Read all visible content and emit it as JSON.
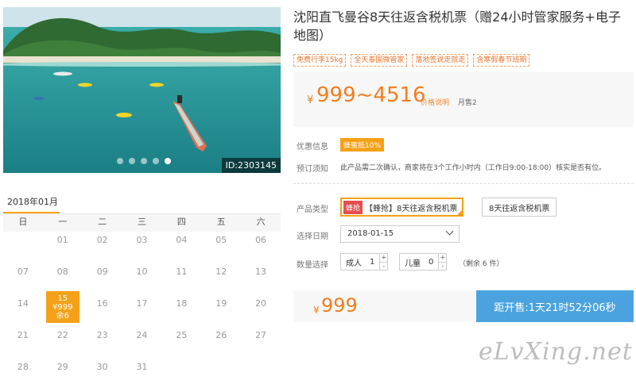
{
  "product": {
    "title": "沈阳直飞曼谷8天往返含税机票（赠24小时管家服务+电子地图）",
    "tags": [
      "免费行李15kg",
      "全天泰国微管家",
      "落地签说走就走",
      "含寒假春节班期"
    ],
    "price_currency": "¥",
    "price_range": "999~4516",
    "price_explain": "价格说明",
    "monthly_sold": "月售2"
  },
  "photo": {
    "id_label": "ID:2303145",
    "slide_count": 5,
    "active_slide": 5
  },
  "info": {
    "promo_label": "优惠信息",
    "promo_badge": "蜂蜜抵10%",
    "notice_label": "预订须知",
    "notice_text": "此产品需二次确认，商家将在3个工作小时内（工作日9:00-18:00）核实是否有位。"
  },
  "options": {
    "type_label": "产品类型",
    "types": [
      {
        "badge": "蜂抢",
        "label": "【蜂抢】8天往返含税机票",
        "selected": true
      },
      {
        "badge": "",
        "label": "8天往返含税机票",
        "selected": false
      }
    ],
    "date_label": "选择日期",
    "date_value": "2018-01-15",
    "qty_label": "数量选择",
    "adult_label": "成人",
    "adult_value": "1",
    "child_label": "儿童",
    "child_value": "0",
    "remaining": "（剩余 6 件）",
    "plus": "+",
    "minus": "-"
  },
  "purchase": {
    "currency": "¥",
    "price": "999",
    "countdown": "距开售:1天21时52分06秒"
  },
  "calendar": {
    "month_label": "2018年01月",
    "weekdays": [
      "日",
      "一",
      "二",
      "三",
      "四",
      "五",
      "六"
    ],
    "days": [
      {
        "day": ""
      },
      {
        "day": "01"
      },
      {
        "day": "02"
      },
      {
        "day": "03"
      },
      {
        "day": "04"
      },
      {
        "day": "05"
      },
      {
        "day": "06"
      },
      {
        "day": "07"
      },
      {
        "day": "08"
      },
      {
        "day": "09"
      },
      {
        "day": "10"
      },
      {
        "day": "11"
      },
      {
        "day": "12"
      },
      {
        "day": "13"
      },
      {
        "day": "14"
      },
      {
        "day": "15",
        "price": "¥999",
        "stock": "余6",
        "selected": true
      },
      {
        "day": "16"
      },
      {
        "day": "17"
      },
      {
        "day": "18"
      },
      {
        "day": "19"
      },
      {
        "day": "20"
      },
      {
        "day": "21"
      },
      {
        "day": "22"
      },
      {
        "day": "23"
      },
      {
        "day": "24"
      },
      {
        "day": "25"
      },
      {
        "day": "26"
      },
      {
        "day": "27"
      },
      {
        "day": "28"
      },
      {
        "day": "29"
      },
      {
        "day": "30"
      },
      {
        "day": "31"
      },
      {
        "day": ""
      },
      {
        "day": ""
      },
      {
        "day": ""
      }
    ]
  },
  "watermark": "eLvXing.net",
  "colors": {
    "accent": "#f5a118",
    "price": "#f27d1e",
    "countdown_bg": "#4aa3df",
    "badge_red": "#e84d4d"
  }
}
